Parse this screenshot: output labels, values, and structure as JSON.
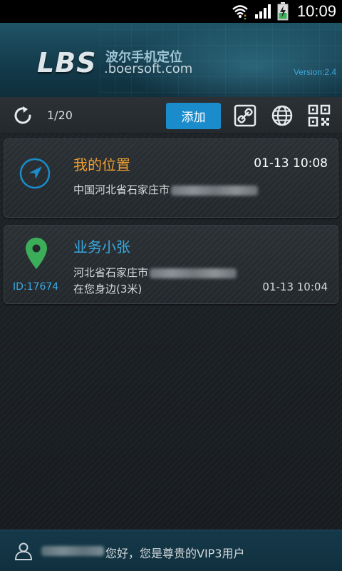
{
  "status_bar": {
    "time": "10:09",
    "icons": [
      "wifi-icon",
      "signal-icon",
      "battery-charging-icon"
    ]
  },
  "header": {
    "logo_main": "LBS",
    "logo_cn": "波尔手机定位",
    "logo_domain": ".boersoft.com",
    "version": "Version:2.4"
  },
  "toolbar": {
    "page_count": "1/20",
    "add_label": "添加",
    "icons": [
      "refresh-icon",
      "share-link-icon",
      "globe-icon",
      "qr-code-icon"
    ]
  },
  "cards": [
    {
      "name": "我的位置",
      "time": "01-13 10:08",
      "address": "中国河北省石家庄市",
      "icon": "navigation-arrow-icon",
      "name_color": "#f0a030"
    },
    {
      "name": "业务小张",
      "id": "ID:17674",
      "address": "河北省石家庄市",
      "distance": "在您身边(3米)",
      "time": "01-13 10:04",
      "icon": "map-pin-icon",
      "name_color": "#39a8e0"
    }
  ],
  "footer": {
    "welcome": "您好，您是尊贵的VIP3用户",
    "icon": "user-icon"
  },
  "colors": {
    "accent": "#1a8ccc",
    "orange": "#f0a030",
    "blue_text": "#39a8e0",
    "pin_green": "#3cae5a"
  }
}
